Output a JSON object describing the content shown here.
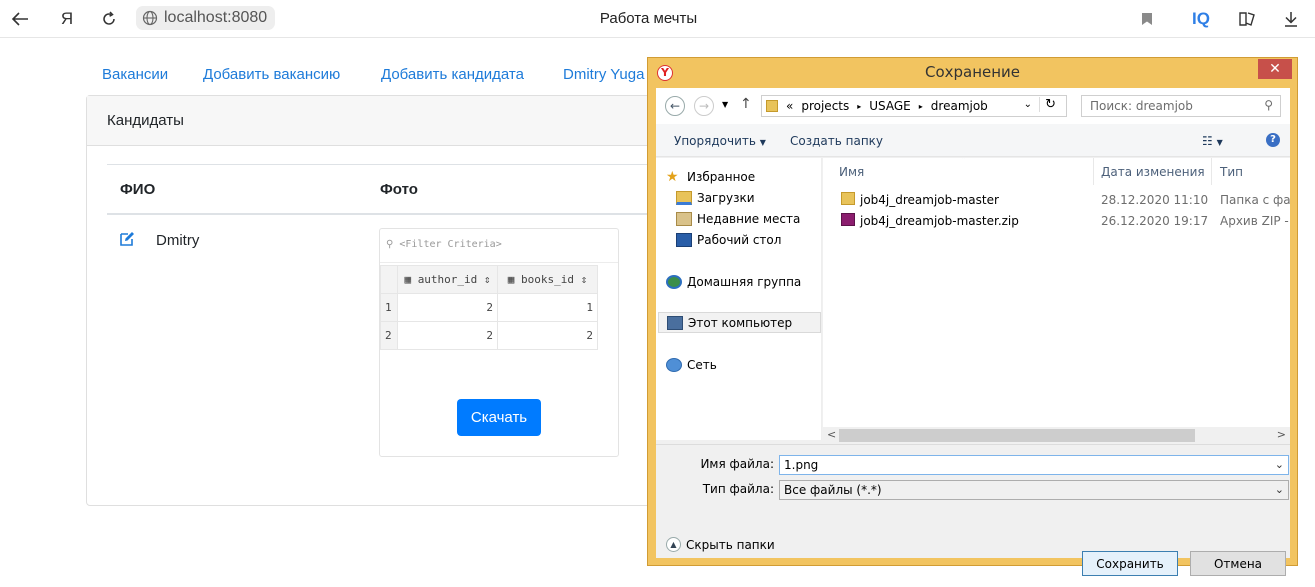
{
  "browser": {
    "url": "localhost:8080",
    "page_title": "Работа мечты",
    "yandex_glyph": "Я",
    "iq_label": "IQ"
  },
  "nav": {
    "links": [
      "Вакансии",
      "Добавить вакансию",
      "Добавить кандидата",
      "Dmitry Yuga"
    ]
  },
  "card": {
    "header": "Кандидаты",
    "columns": {
      "name": "ФИО",
      "photo": "Фото"
    },
    "candidate": {
      "name": "Dmitry"
    },
    "photo": {
      "filter_placeholder": "<Filter Criteria>",
      "headers": [
        "author_id",
        "books_id"
      ],
      "rows": [
        {
          "n": "1",
          "author_id": "2",
          "books_id": "1"
        },
        {
          "n": "2",
          "author_id": "2",
          "books_id": "2"
        }
      ]
    },
    "download_label": "Скачать"
  },
  "dialog": {
    "title": "Сохранение",
    "close_glyph": "✕",
    "breadcrumb": [
      "«",
      "projects",
      "USAGE",
      "dreamjob"
    ],
    "search_placeholder": "Поиск: dreamjob",
    "organize_label": "Упорядочить",
    "new_folder_label": "Создать папку",
    "help_glyph": "?",
    "nav_items": {
      "favorites": "Избранное",
      "downloads": "Загрузки",
      "recent": "Недавние места",
      "desktop": "Рабочий стол",
      "homegroup": "Домашняя группа",
      "computer": "Этот компьютер",
      "network": "Сеть"
    },
    "columns": {
      "name": "Имя",
      "date": "Дата изменения",
      "type": "Тип"
    },
    "files": [
      {
        "name": "job4j_dreamjob-master",
        "date": "28.12.2020 11:10",
        "type": "Папка с файла"
      },
      {
        "name": "job4j_dreamjob-master.zip",
        "date": "26.12.2020 19:17",
        "type": "Архив ZIP - Wir"
      }
    ],
    "filename_label": "Имя файла:",
    "filename_value": "1.png",
    "filetype_label": "Тип файла:",
    "filetype_value": "Все файлы (*.*)",
    "hide_folders_label": "Скрыть папки",
    "save_label": "Сохранить",
    "cancel_label": "Отмена"
  }
}
